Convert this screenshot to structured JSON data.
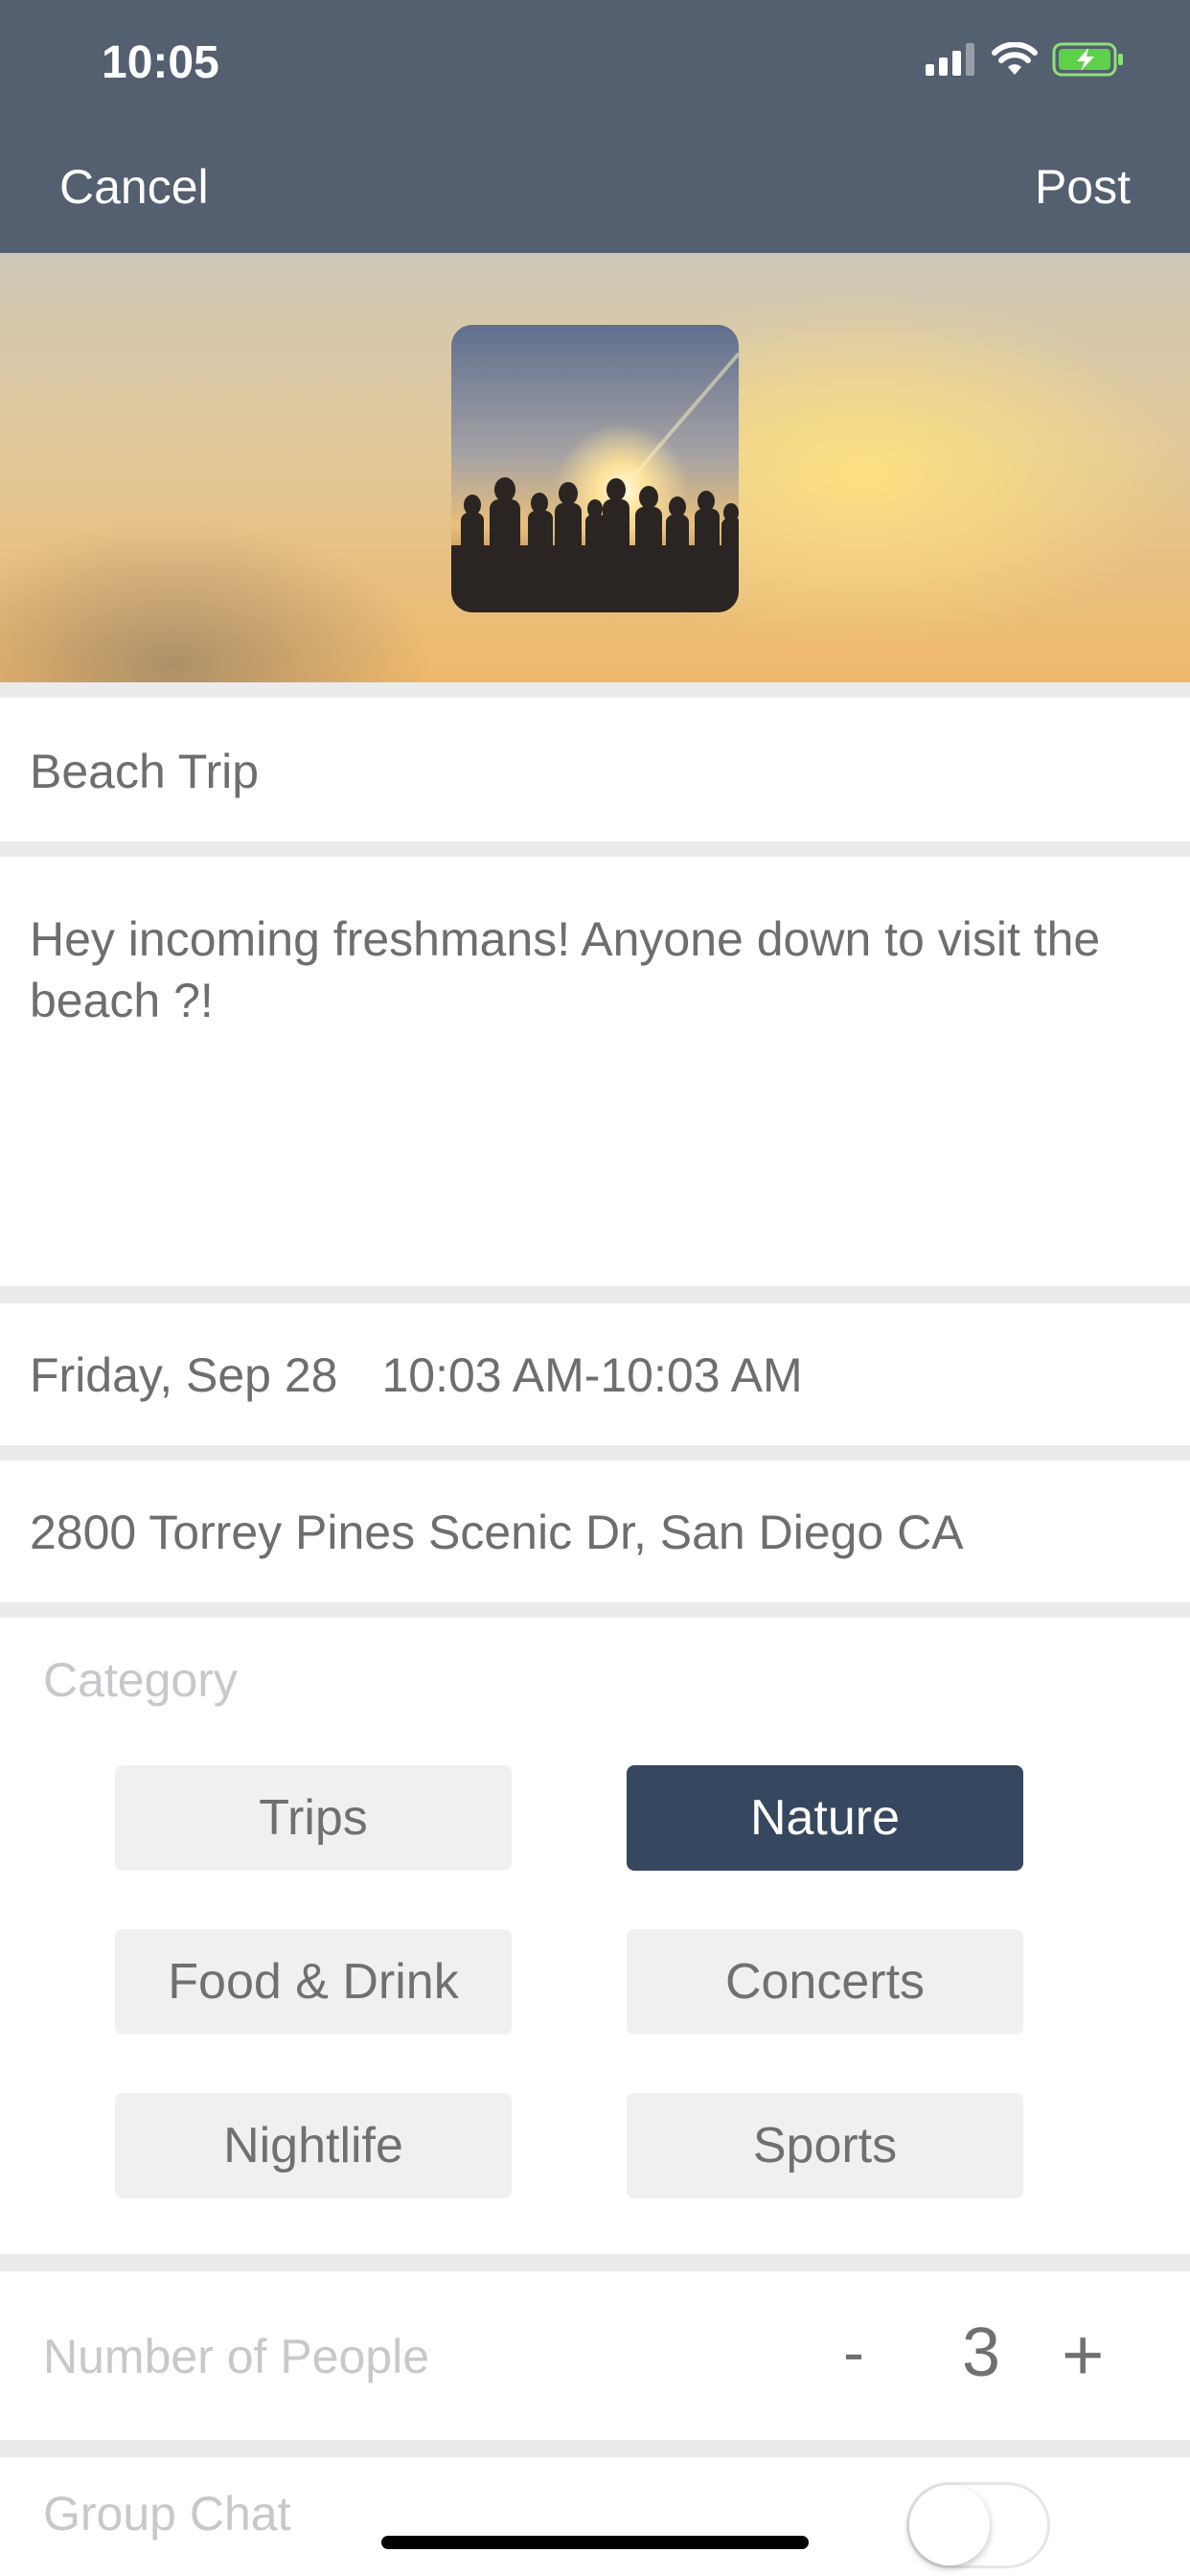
{
  "status_bar": {
    "time": "10:05"
  },
  "nav": {
    "cancel_label": "Cancel",
    "post_label": "Post"
  },
  "event": {
    "title": "Beach Trip",
    "description": "Hey incoming freshmans! Anyone down to visit the beach ?!",
    "date": "Friday, Sep 28",
    "time_range": "10:03 AM-10:03 AM",
    "location": "2800 Torrey Pines Scenic Dr, San Diego CA"
  },
  "category": {
    "label": "Category",
    "options": [
      "Trips",
      "Nature",
      "Food & Drink",
      "Concerts",
      "Nightlife",
      "Sports"
    ],
    "selected": "Nature"
  },
  "people": {
    "label": "Number of People",
    "minus": "-",
    "value": "3",
    "plus": "+"
  },
  "group_chat": {
    "label": "Group Chat",
    "enabled": false
  },
  "colors": {
    "nav_bg": "#545f70",
    "selected_chip": "#364760",
    "chip_bg": "#f0f0f0"
  },
  "icons": [
    "signal-icon",
    "wifi-icon",
    "battery-charging-icon"
  ]
}
